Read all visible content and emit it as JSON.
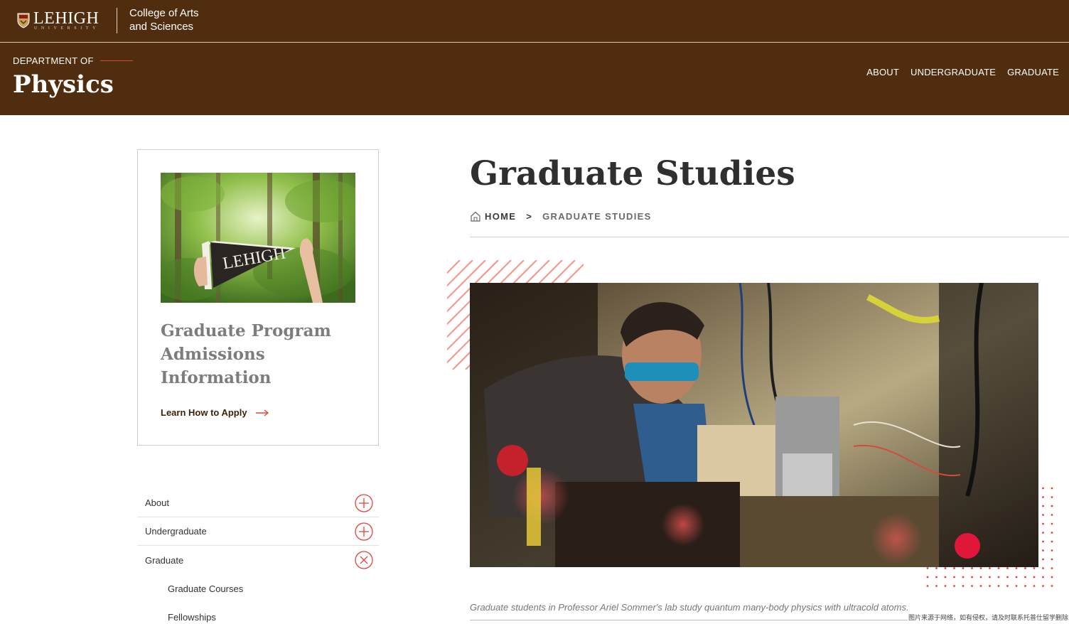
{
  "header": {
    "logo": {
      "name": "LEHIGH",
      "sub": "UNIVERSITY"
    },
    "college": {
      "line1": "College of Arts",
      "line2": "and Sciences"
    },
    "department_prefix": "DEPARTMENT OF",
    "department_name": "Physics",
    "nav": [
      {
        "label": "ABOUT"
      },
      {
        "label": "UNDERGRADUATE"
      },
      {
        "label": "GRADUATE"
      }
    ],
    "background_color": "#502d0e",
    "accent_color": "#e0463c"
  },
  "promo": {
    "image_icon": "lehigh-pennant-photo",
    "title": "Graduate Program Admissions Information",
    "link_label": "Learn How to Apply",
    "link_icon": "arrow-right-icon"
  },
  "sidenav": {
    "items": [
      {
        "label": "About",
        "state": "collapsed",
        "icon": "plus-circle-icon"
      },
      {
        "label": "Undergraduate",
        "state": "collapsed",
        "icon": "plus-circle-icon"
      },
      {
        "label": "Graduate",
        "state": "expanded",
        "icon": "close-circle-icon"
      }
    ],
    "graduate_children": [
      {
        "label": "Graduate Courses"
      },
      {
        "label": "Fellowships"
      }
    ]
  },
  "main": {
    "title": "Graduate Studies",
    "breadcrumb": {
      "home": "HOME",
      "separator": ">",
      "current": "GRADUATE STUDIES"
    },
    "hero_image_icon": "lab-researcher-photo",
    "caption": "Graduate students in Professor Ariel Sommer's lab study quantum many-body physics with ultracold atoms."
  },
  "watermark": "图片来源于网络，如有侵权，请及时联系托普仕留学删除"
}
